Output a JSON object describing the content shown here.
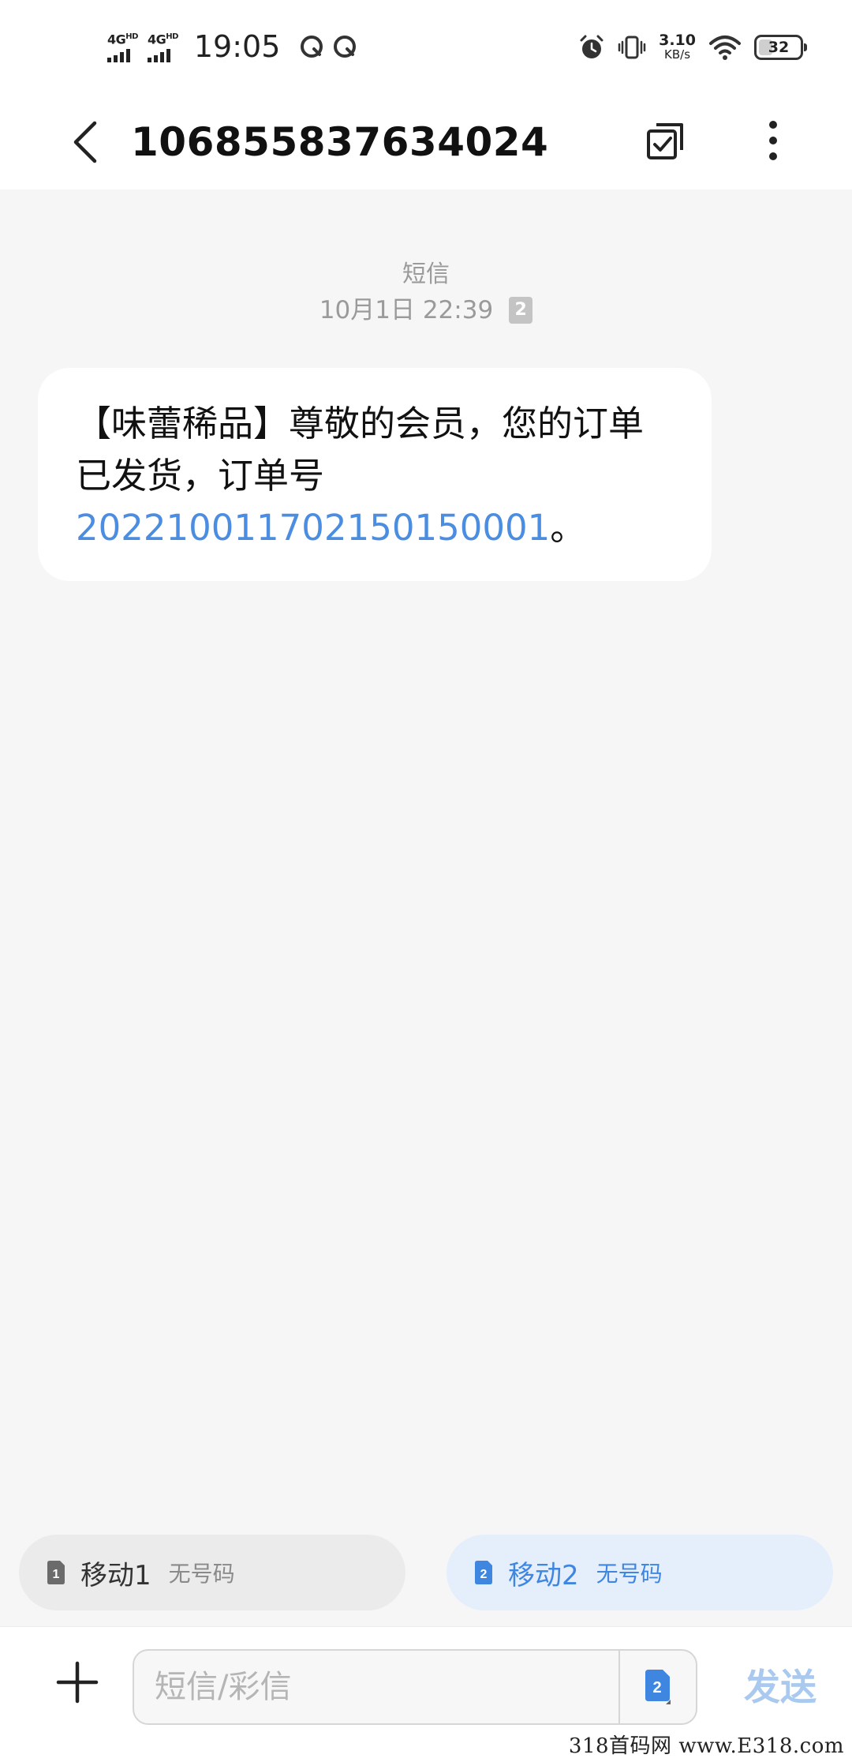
{
  "status_bar": {
    "network_1": "4G",
    "network_1_sup": "HD",
    "network_2": "4G",
    "network_2_sup": "HD",
    "time": "19:05",
    "speed_value": "3.10",
    "speed_unit": "KB/s",
    "battery_level": "32",
    "icons": [
      "signal-icon",
      "q-notification-icon",
      "alarm-icon",
      "vibrate-icon",
      "wifi-icon",
      "battery-icon"
    ]
  },
  "header": {
    "title": "106855837634024",
    "icons": [
      "back-arrow-icon",
      "select-checkbox-icon",
      "more-vertical-icon"
    ]
  },
  "message": {
    "type_label": "短信",
    "timestamp": "10月1日  22:39",
    "sim_badge": "2",
    "body_prefix": "【味蕾稀品】尊敬的会员，您的订单已发货，订单号",
    "order_number": "202210011702150150001",
    "body_suffix": "。"
  },
  "sim_selector": {
    "sim1": {
      "badge": "1",
      "name": "移动1",
      "sub": "无号码",
      "selected": false
    },
    "sim2": {
      "badge": "2",
      "name": "移动2",
      "sub": "无号码",
      "selected": true
    }
  },
  "composer": {
    "placeholder": "短信/彩信",
    "sim_badge": "2",
    "send_label": "发送"
  },
  "watermark": "318首码网  www.E318.com",
  "colors": {
    "accent": "#4b8de0",
    "send_disabled": "#a9c9ef",
    "background": "#f6f6f6",
    "bubble": "#ffffff"
  }
}
